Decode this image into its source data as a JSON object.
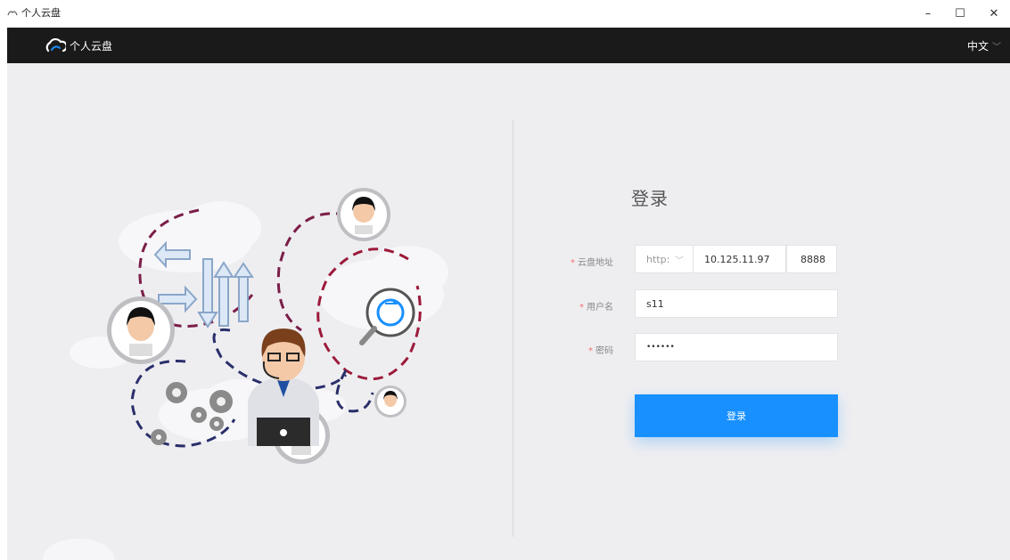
{
  "window": {
    "title": "个人云盘",
    "minimize_glyph": "–",
    "maximize_glyph": "☐",
    "close_glyph": "✕"
  },
  "header": {
    "brand_name": "个人云盘",
    "language": "中文",
    "language_chevron": "﹀"
  },
  "login": {
    "title": "登录",
    "required_mark": "*",
    "server": {
      "label": "云盘地址",
      "protocol": "http:",
      "protocol_chevron": "﹀",
      "host": "10.125.11.97",
      "port": "8888"
    },
    "username": {
      "label": "用户名",
      "value": "s11"
    },
    "password": {
      "label": "密码",
      "value": "••••••"
    },
    "submit_label": "登录"
  },
  "colors": {
    "header_bg": "#1a1a1a",
    "main_bg": "#eeeef1",
    "primary": "#1890ff",
    "required": "#f56c6c"
  }
}
